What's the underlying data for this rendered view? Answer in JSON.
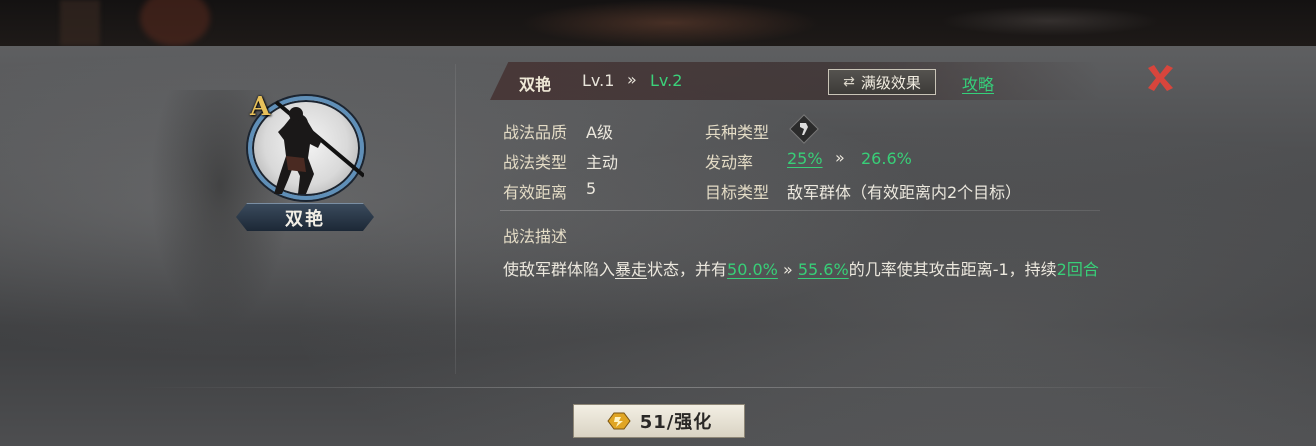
{
  "skill": {
    "name": "双艳",
    "quality_badge": "A",
    "level_from": "Lv.1",
    "level_arrow": "»",
    "level_to": "Lv.2"
  },
  "header": {
    "max_effect_label": "满级效果",
    "guide_label": "攻略"
  },
  "info": {
    "quality_label": "战法品质",
    "quality_value": "A级",
    "type_label": "战法类型",
    "type_value": "主动",
    "range_label": "有效距离",
    "range_value": "5",
    "troop_label": "兵种类型",
    "trigger_label": "发动率",
    "trigger_from": "25%",
    "trigger_arrow": "»",
    "trigger_to": "26.6%",
    "target_label": "目标类型",
    "target_value": "敌军群体（有效距离内2个目标）"
  },
  "description": {
    "title": "战法描述",
    "part1": "使敌军群体陷入",
    "status": "暴走",
    "part2": "状态，并有",
    "rate_from": "50.0%",
    "arrow": "»",
    "rate_to": "55.6%",
    "part3": "的几率使其攻击距离-1，持续",
    "duration": "2回合"
  },
  "footer": {
    "enhance_label": "51/强化"
  },
  "icons": {
    "close": "close-icon",
    "swap": "swap-icon",
    "troop": "troop-type-icon",
    "enhance": "enhance-icon"
  },
  "colors": {
    "accent_green": "#38cf78",
    "close_red": "#d8453c",
    "quality_gold": "#e8c15a",
    "portrait_ring": "#5f8fb8"
  }
}
